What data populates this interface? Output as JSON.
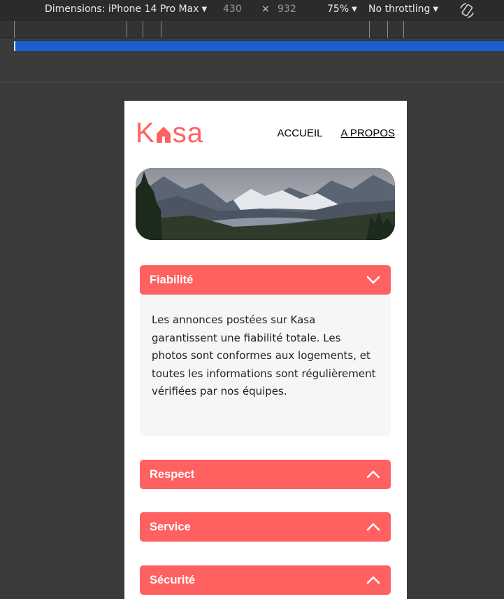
{
  "devtools": {
    "dimensions_label": "Dimensions: iPhone 14 Pro Max",
    "width": "430",
    "times": "×",
    "height": "932",
    "zoom": "75%",
    "throttling": "No throttling",
    "rotate_icon": "rotate-icon"
  },
  "site": {
    "logo_k": "K",
    "logo_rest": "sa",
    "nav": [
      {
        "label": "ACCUEIL",
        "active": false
      },
      {
        "label": "A PROPOS",
        "active": true
      }
    ],
    "banner": "mountain-landscape-image",
    "accent_color": "#ff6060"
  },
  "collapses": [
    {
      "title": "Fiabilité",
      "open": true,
      "text": "Les annonces postées sur Kasa garantissent une fiabilité totale. Les photos sont conformes aux logements, et toutes les informations sont régulièrement vérifiées par nos équipes."
    },
    {
      "title": "Respect",
      "open": false
    },
    {
      "title": "Service",
      "open": false
    },
    {
      "title": "Sécurité",
      "open": false
    }
  ]
}
